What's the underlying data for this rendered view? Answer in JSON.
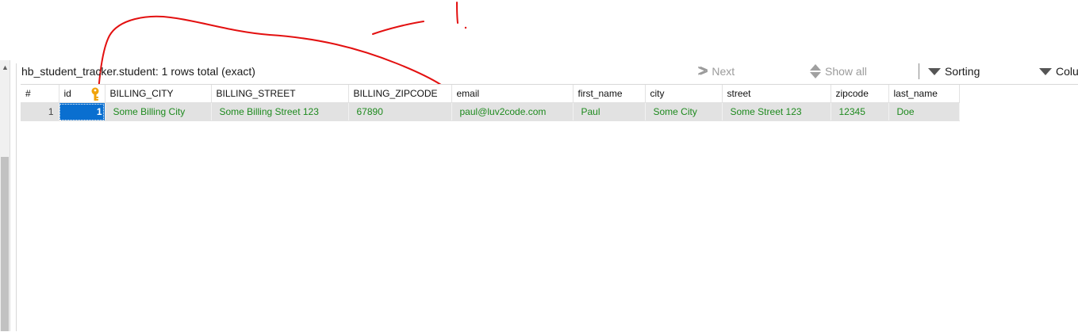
{
  "toolbar": {
    "table_title": "hb_student_tracker.student: 1 rows total (exact)",
    "next_label": "Next",
    "show_all_label": "Show all",
    "sorting_label": "Sorting",
    "columns_label": "Colu"
  },
  "grid": {
    "columns": [
      "#",
      "id",
      "BILLING_CITY",
      "BILLING_STREET",
      "BILLING_ZIPCODE",
      "email",
      "first_name",
      "city",
      "street",
      "zipcode",
      "last_name"
    ],
    "rows": [
      {
        "rownum": "1",
        "id": "1",
        "BILLING_CITY": "Some Billing City",
        "BILLING_STREET": "Some Billing Street 123",
        "BILLING_ZIPCODE": "67890",
        "email": "paul@luv2code.com",
        "first_name": "Paul",
        "city": "Some City",
        "street": "Some Street 123",
        "zipcode": "12345",
        "last_name": "Doe"
      }
    ]
  },
  "colors": {
    "value_text": "#1e8a1e",
    "selected_cell": "#0a6fd0",
    "annotation": "#e31010",
    "key_icon": "#f0a30a"
  },
  "icons": {
    "next": "double-chevron-right-icon",
    "show_all": "up-down-arrows-icon",
    "sorting": "triangle-down-icon",
    "columns": "triangle-down-icon",
    "primary_key": "key-icon"
  }
}
